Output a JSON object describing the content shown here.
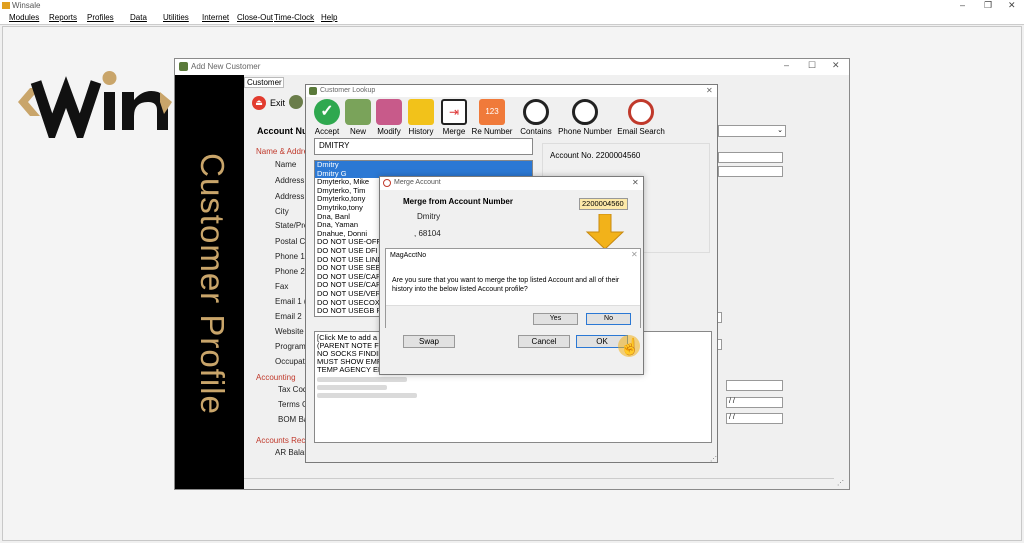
{
  "app": {
    "title": "Winsale",
    "min": "–",
    "restore": "❐",
    "close": "✕"
  },
  "menu": [
    "Modules",
    "Reports",
    "Profiles",
    "Data",
    "Utilities",
    "Internet",
    "Close-Out",
    "Time-Clock",
    "Help"
  ],
  "add_customer": {
    "title": "Add New Customer",
    "tab": "Customer",
    "exit_label": "Exit",
    "sidebar_text": "Customer Profile",
    "account_label": "Account Nu",
    "section_name": "Name & Addres",
    "labels": [
      "Name",
      "Address",
      "Address",
      "City",
      "State/Prov",
      "Postal Co",
      "Phone 1",
      "Phone 2",
      "Fax",
      "Email 1 (m",
      "Email 2",
      "Website U",
      "Program I",
      "Occupatio"
    ],
    "section_accounting": "Accounting",
    "acct_labels": [
      "Tax Code",
      "Terms Co",
      "BOM Bal"
    ],
    "section_receivable": "Accounts Recei",
    "ar_label": "AR Balan",
    "date_placeholder_1": " / /",
    "date_placeholder_2": " / /",
    "side_text": "ners"
  },
  "lookup": {
    "title": "Customer Lookup",
    "toolbar": [
      "Accept",
      "New",
      "Modify",
      "History",
      "Merge",
      "Re Number",
      "Contains",
      "Phone Number",
      "Email Search"
    ],
    "search_value": "DMITRY",
    "account_no": "Account No. 2200004560",
    "list": [
      "Dmitry",
      "Dmitry G",
      "Dmyterko, Mike",
      "Dmyterko, Tim",
      "Dmyterko,tony",
      "Dmytriko,tony",
      "Dna, Banl",
      "Dna, Yaman",
      "Dnahue, Donni",
      "DO NOT USE-OFFI",
      "DO NOT USE DFI S",
      "DO NOT USE LINDS",
      "DO NOT USE SEE I",
      "DO NOT USE/CARC",
      "DO NOT USE/CARC",
      "DO NOT USE/VERI",
      "DO NOT USECOX C",
      "DO NOT USEGB RA"
    ],
    "notes": [
      "[Click Me to add a n",
      "(PARENT NOTE FO",
      "NO SOCKS FINDIN",
      "MUST SHOW EMPL",
      "TEMP AGENCY EM"
    ]
  },
  "merge": {
    "title": "Merge Account",
    "heading": "Merge from Account Number",
    "account_value": "2200004560",
    "name": "Dmitry",
    "zip": ", 68104",
    "swap": "Swap",
    "cancel": "Cancel",
    "ok": "OK"
  },
  "confirm": {
    "title": "MagAcctNo",
    "message": "Are you sure that you want to merge the top listed Account and all of their history into the below listed Account profile?",
    "yes": "Yes",
    "no": "No"
  },
  "colors": {
    "gold": "#c9a56a",
    "selection": "#2b78d4",
    "arrow": "#f2b21a"
  }
}
